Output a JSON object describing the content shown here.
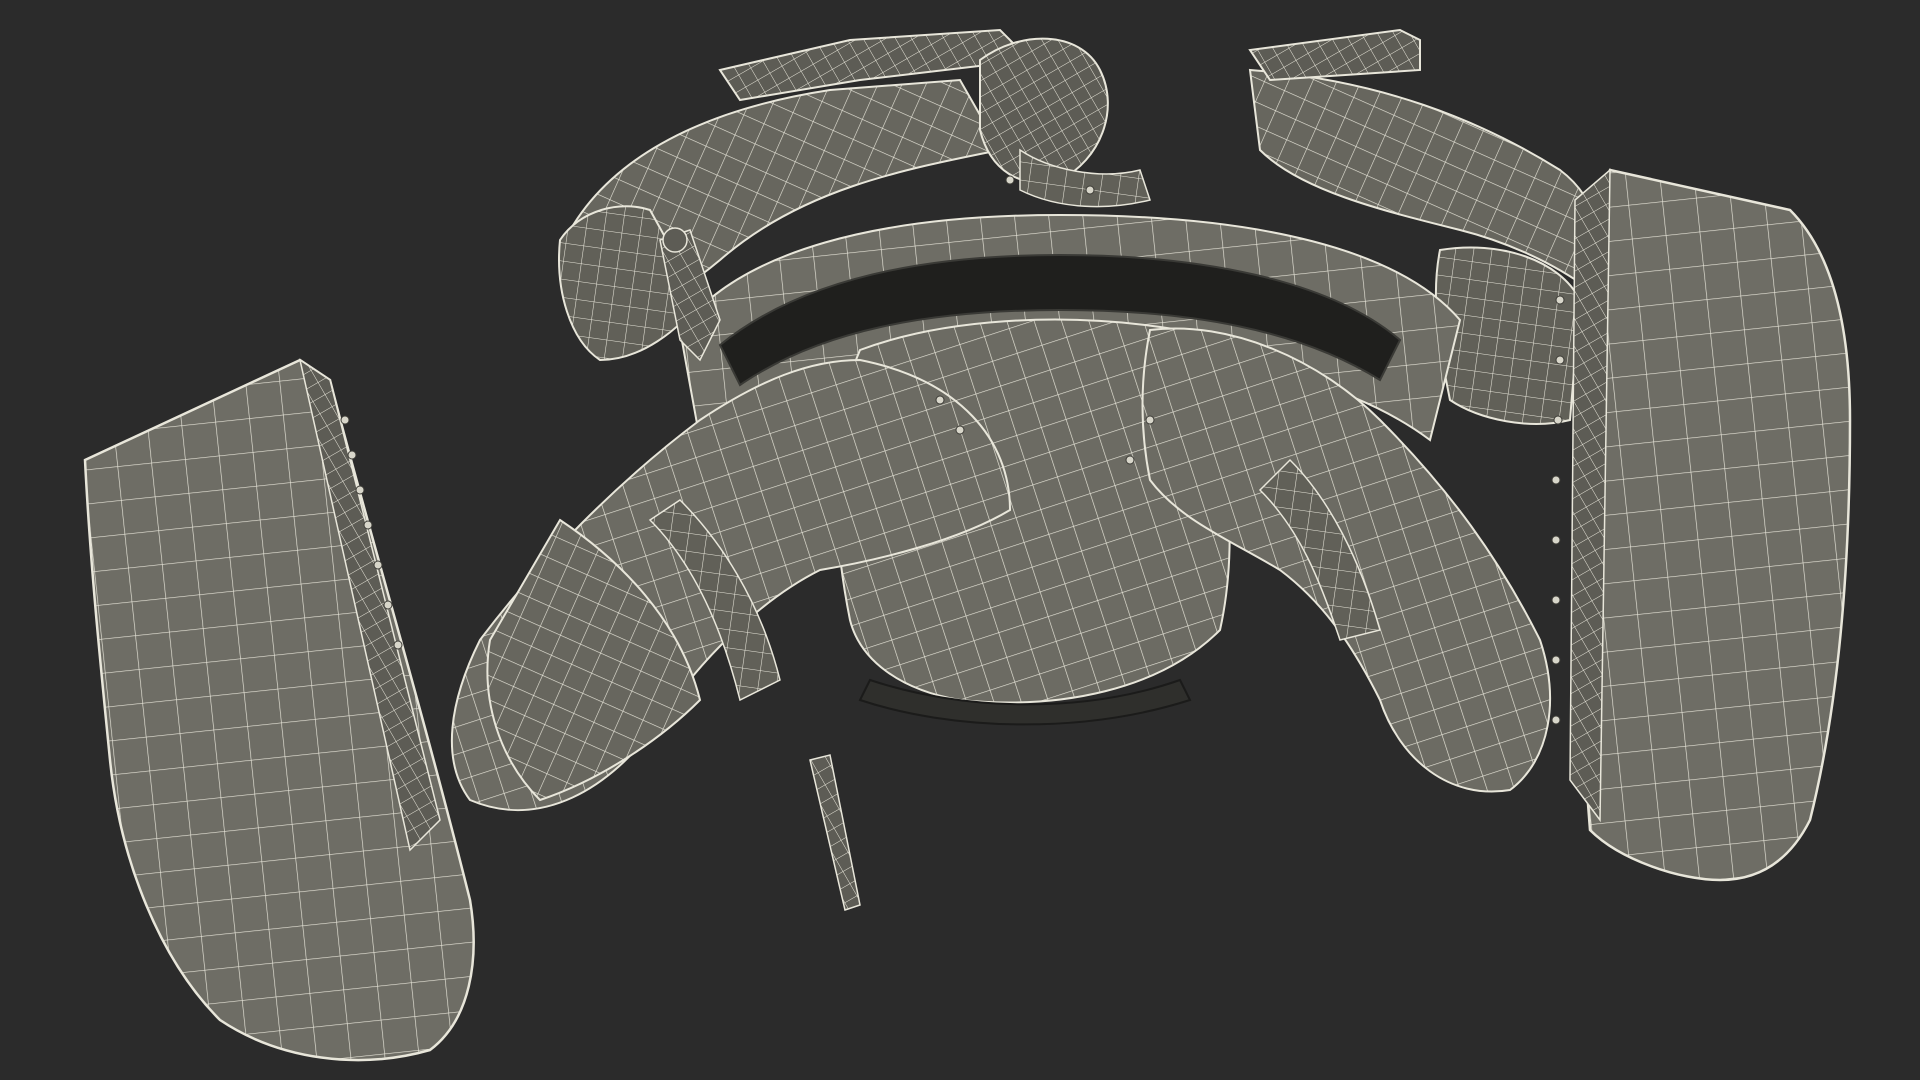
{
  "scene": {
    "background_color": "#2b2b2b",
    "surface_color": "#6c6b63",
    "surface_shadow_color": "#4d4c46",
    "wire_color": "#e8e6da",
    "dark_inner_color": "#1f1f1d",
    "subject_icon": "wireframe-armored-knight-bottom-view",
    "parts": [
      "left-boot",
      "right-boot",
      "left-leg",
      "right-leg",
      "pelvis",
      "skirt-plate",
      "left-arm",
      "right-arm",
      "head",
      "sword-hilt",
      "sword-scabbard-tip"
    ]
  }
}
